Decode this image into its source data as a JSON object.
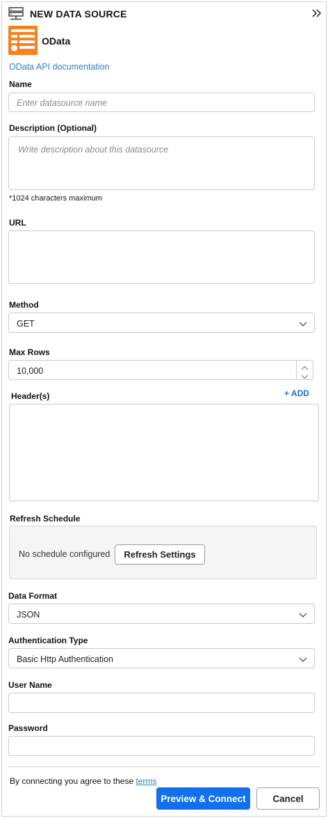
{
  "header": {
    "title": "NEW DATA SOURCE",
    "icon": "database-server-icon",
    "collapse_icon": "double-chevron-right-icon"
  },
  "source": {
    "name": "OData",
    "logo_color": "#f5821f",
    "doc_link": "OData API documentation"
  },
  "form": {
    "name_label": "Name",
    "name_placeholder": "Enter datasource name",
    "description_label": "Description (Optional)",
    "description_placeholder": "Write description about this datasource",
    "description_note": "*1024 characters maximum",
    "url_label": "URL",
    "url_value": "",
    "method_label": "Method",
    "method_value": "GET",
    "max_rows_label": "Max Rows",
    "max_rows_value": "10,000",
    "headers_label": "Header(s)",
    "add_label": "+ ADD",
    "refresh_label": "Refresh Schedule",
    "refresh_status": "No schedule configured",
    "refresh_button": "Refresh Settings",
    "data_format_label": "Data Format",
    "data_format_value": "JSON",
    "auth_label": "Authentication Type",
    "auth_value": "Basic Http Authentication",
    "username_label": "User Name",
    "username_value": "",
    "password_label": "Password",
    "password_value": ""
  },
  "footer": {
    "terms_prefix": "By connecting you agree to these",
    "terms_link": "terms",
    "primary_button": "Preview & Connect",
    "cancel_button": "Cancel"
  },
  "colors": {
    "primary": "#1370ec",
    "link": "#2f7fc1",
    "add": "#1c6ad6"
  }
}
